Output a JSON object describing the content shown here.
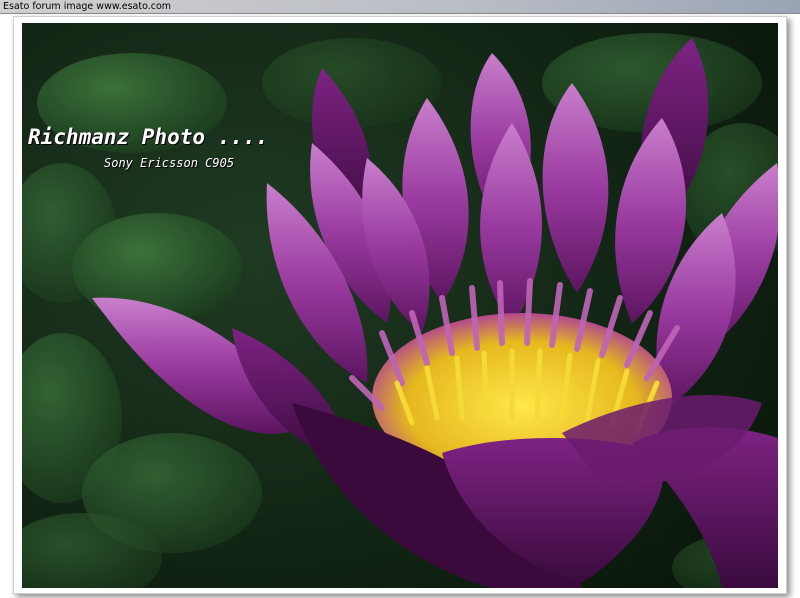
{
  "banner": {
    "text": "Esato forum image www.esato.com"
  },
  "photo": {
    "title_overlay": "Richmanz Photo ....",
    "subtitle_overlay": "Sony Ericsson C905",
    "colors": {
      "background_leaves": "#1d3a22",
      "petal": "#8e2c8e",
      "petal_light": "#c36fc4",
      "stamen": "#f2d22c"
    }
  }
}
